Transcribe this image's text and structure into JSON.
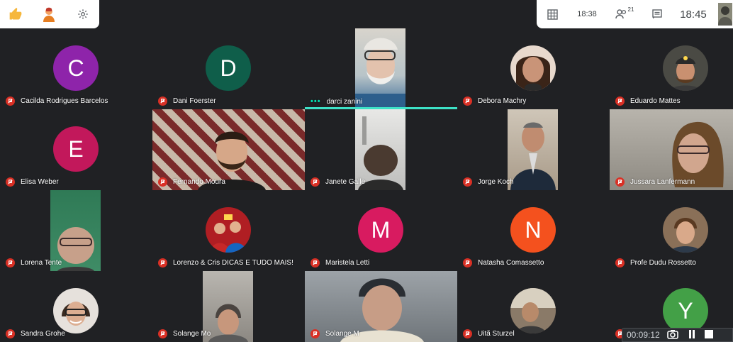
{
  "toolbar_left": {
    "icons": [
      "thumbs-up-icon",
      "raise-hand-icon",
      "settings-gear-icon"
    ]
  },
  "toolbar_right": {
    "icons": [
      "grid-layout-icon",
      "people-icon",
      "chat-icon"
    ],
    "meeting_time": "18:38",
    "participant_count": "21",
    "clock": "18:45"
  },
  "participants": [
    {
      "name": "Cacilda Rodrigues Barcelos",
      "initial": "C",
      "color": "#8e24aa",
      "muted": true
    },
    {
      "name": "Dani Foerster",
      "initial": "D",
      "color": "#0f5e4a",
      "muted": true
    },
    {
      "name": "darci zanini",
      "muted": false,
      "speaking": true
    },
    {
      "name": "Debora Machry",
      "muted": true
    },
    {
      "name": "Eduardo Mattes",
      "muted": true
    },
    {
      "name": "Elisa Weber",
      "initial": "E",
      "color": "#c2185b",
      "muted": true
    },
    {
      "name": "Fernando Moura",
      "muted": true
    },
    {
      "name": "Janete Galle",
      "muted": true
    },
    {
      "name": "Jorge Koch",
      "muted": true
    },
    {
      "name": "Jussara Lanfermann",
      "muted": true
    },
    {
      "name": "Lorena Tente",
      "muted": true
    },
    {
      "name": "Lorenzo & Cris DICAS E TUDO MAIS!",
      "muted": true
    },
    {
      "name": "Maristela Letti",
      "initial": "M",
      "color": "#d81b60",
      "muted": true
    },
    {
      "name": "Natasha Comassetto",
      "initial": "N",
      "color": "#f4511e",
      "muted": true
    },
    {
      "name": "Profe Dudu Rossetto",
      "muted": true
    },
    {
      "name": "Sandra Grohe",
      "muted": true
    },
    {
      "name": "Solange Mo",
      "muted": true
    },
    {
      "name": "Solange M",
      "muted": true
    },
    {
      "name": "Uitã Sturzel",
      "muted": true
    },
    {
      "name": "Y",
      "initial": "Y",
      "color": "#43a047",
      "muted": true
    }
  ],
  "recorder": {
    "elapsed": "00:09:12",
    "icons": [
      "camera-icon",
      "pause-icon",
      "stop-icon"
    ]
  }
}
